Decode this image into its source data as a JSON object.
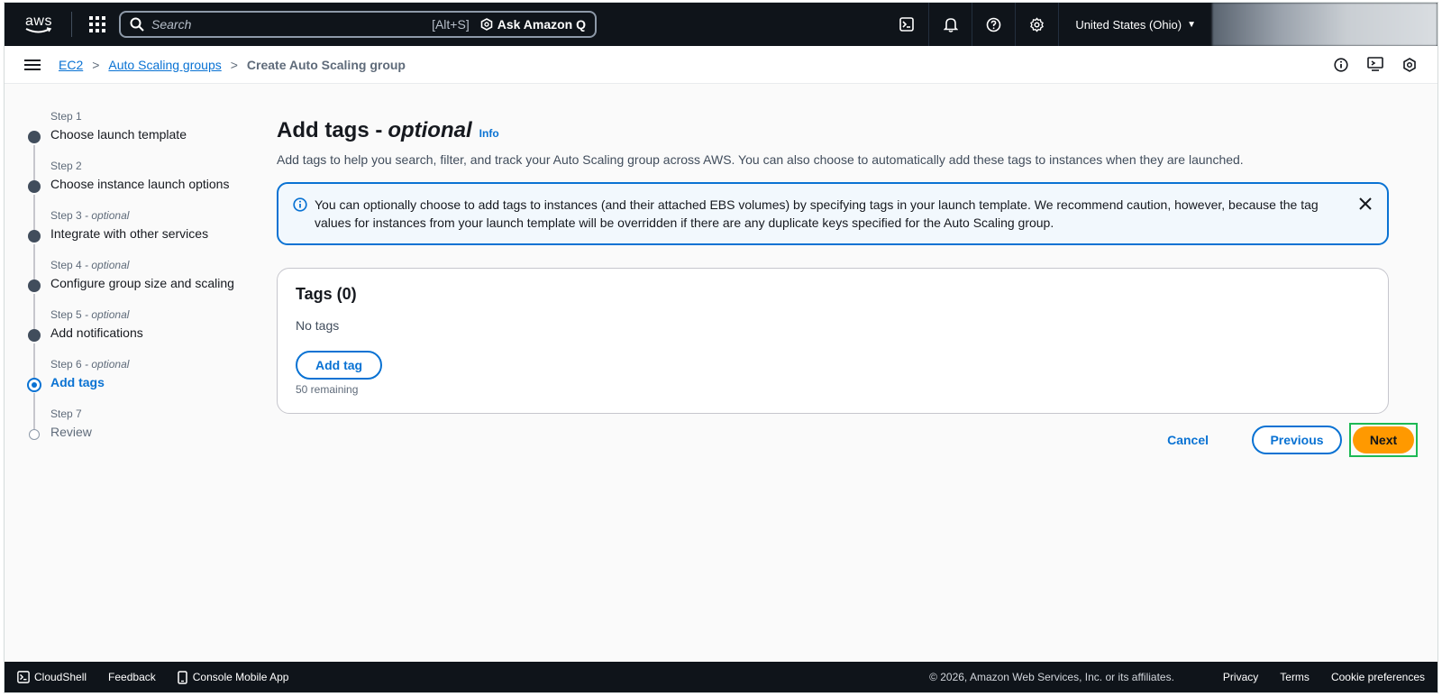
{
  "topnav": {
    "logo_text": "aws",
    "search_placeholder": "Search",
    "search_shortcut": "[Alt+S]",
    "ask_q_label": "Ask Amazon Q",
    "region_label": "United States (Ohio)"
  },
  "breadcrumb": {
    "items": [
      "EC2",
      "Auto Scaling groups"
    ],
    "current": "Create Auto Scaling group"
  },
  "steps": [
    {
      "label": "Step 1",
      "optional": "",
      "title": "Choose launch template",
      "state": "done"
    },
    {
      "label": "Step 2",
      "optional": "",
      "title": "Choose instance launch options",
      "state": "done"
    },
    {
      "label": "Step 3",
      "optional": " - optional",
      "title": "Integrate with other services",
      "state": "done"
    },
    {
      "label": "Step 4",
      "optional": " - optional",
      "title": "Configure group size and scaling",
      "state": "done"
    },
    {
      "label": "Step 5",
      "optional": " - optional",
      "title": "Add notifications",
      "state": "done"
    },
    {
      "label": "Step 6",
      "optional": " - optional",
      "title": "Add tags",
      "state": "active"
    },
    {
      "label": "Step 7",
      "optional": "",
      "title": "Review",
      "state": "future"
    }
  ],
  "main": {
    "title": "Add tags -",
    "title_optional": "optional",
    "info_label": "Info",
    "description": "Add tags to help you search, filter, and track your Auto Scaling group across AWS. You can also choose to automatically add these tags to instances when they are launched.",
    "alert_text": "You can optionally choose to add tags to instances (and their attached EBS volumes) by specifying tags in your launch template. We recommend caution, however, because the tag values for instances from your launch template will be overridden if there are any duplicate keys specified for the Auto Scaling group.",
    "tags_title": "Tags (0)",
    "no_tags": "No tags",
    "add_tag_label": "Add tag",
    "remaining": "50 remaining"
  },
  "actions": {
    "cancel": "Cancel",
    "previous": "Previous",
    "next": "Next"
  },
  "footer": {
    "cloudshell": "CloudShell",
    "feedback": "Feedback",
    "mobile_app": "Console Mobile App",
    "copyright": "© 2026, Amazon Web Services, Inc. or its affiliates.",
    "privacy": "Privacy",
    "terms": "Terms",
    "cookies": "Cookie preferences"
  },
  "colors": {
    "nav_bg": "#0f141a",
    "link": "#0972d3",
    "primary": "#ff9900",
    "highlight": "#1db954"
  }
}
